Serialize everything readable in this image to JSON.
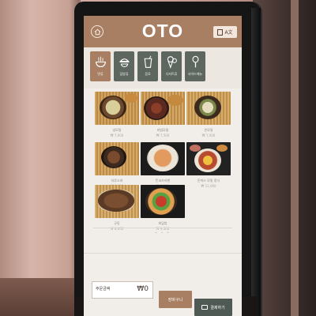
{
  "header": {
    "logo": "OTO",
    "lang_label": "A文"
  },
  "categories": [
    {
      "icon": "noodle-bowl-icon",
      "label": "면류",
      "active": true
    },
    {
      "icon": "rice-bowl-icon",
      "label": "덮밥류",
      "active": false
    },
    {
      "icon": "drink-cup-icon",
      "label": "음료",
      "active": false
    },
    {
      "icon": "ice-cream-icon",
      "label": "디저트류",
      "active": false
    },
    {
      "icon": "spoon-icon",
      "label": "사이드메뉴",
      "active": false
    }
  ],
  "menu": [
    {
      "name": "냉모밀",
      "price": "₩ 7,000"
    },
    {
      "name": "비빔모밀",
      "price": "₩ 7,500"
    },
    {
      "name": "온모밀",
      "price": "₩ 7,000"
    },
    {
      "name": "자루소바",
      "price": "₩ 8,000"
    },
    {
      "name": "돈코츠라멘",
      "price": "₩ 8,500"
    },
    {
      "name": "돈까스 모밀 정식",
      "price": "₩ 11,000"
    },
    {
      "name": "규동",
      "price": "₩ 8,000"
    },
    {
      "name": "회덮밥",
      "price": "₩ 9,500"
    }
  ],
  "pagination": "•  •  •",
  "order": {
    "total_label": "주문금액",
    "total_value": "₩0",
    "cart_label": "장바구니",
    "pay_label": "결제하기"
  },
  "colors": {
    "accent": "#a97f63",
    "dark_tab": "#5e6660",
    "pay": "#4f5a55",
    "screen_bg": "#f1ede8"
  }
}
